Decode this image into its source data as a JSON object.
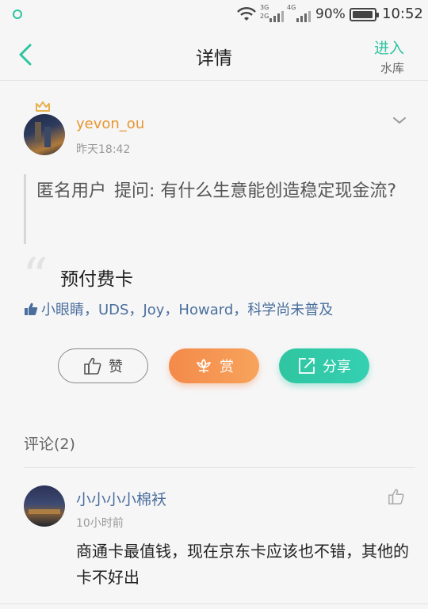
{
  "status_bar": {
    "net_label_1_top": "3G",
    "net_label_1_bottom": "2G",
    "net_label_2": "4G",
    "battery": "90%",
    "time": "10:52"
  },
  "header": {
    "title": "详情",
    "action_label": "进入",
    "action_sub": "水库"
  },
  "post": {
    "user": "yevon_ou",
    "time": "昨天18:42",
    "question_user": "匿名用户",
    "question_text": "提问: 有什么生意能创造稳定现金流?",
    "answer": "预付费卡",
    "likers": "小眼睛，UDS，Joy，Howard，科学尚未普及"
  },
  "actions": {
    "like_label": "赞",
    "reward_label": "赏",
    "share_label": "分享"
  },
  "comments": {
    "title": "评论(2)",
    "items": [
      {
        "user": "小小小小棉袄",
        "time": "10小时前",
        "text": "商通卡最值钱，现在京东卡应该也不错，其他的卡不好出"
      }
    ]
  },
  "colors": {
    "accent_green": "#2ec4a0",
    "username_orange": "#e8962f",
    "link_blue": "#4a6f9d",
    "reward_orange": "#f48a4a"
  }
}
